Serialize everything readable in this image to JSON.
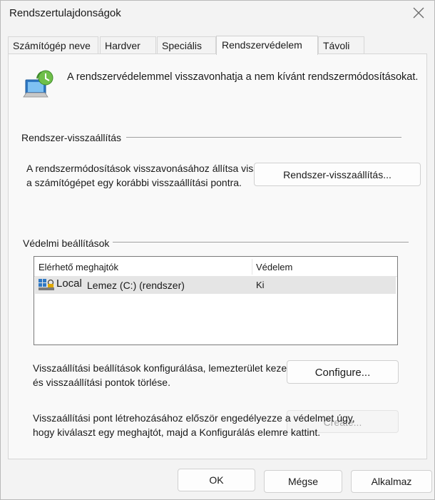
{
  "window": {
    "title": "Rendszertulajdonságok",
    "close_icon": "close-icon"
  },
  "tabs": [
    {
      "label": "Számítógép neve"
    },
    {
      "label": "Hardver"
    },
    {
      "label": "Speciális"
    },
    {
      "label": "Rendszervédelem"
    },
    {
      "label": "Távoli"
    }
  ],
  "header": {
    "icon": "system-protection-icon",
    "description": "A rendszervédelemmel visszavonhatja a nem kívánt rendszermódosításokat."
  },
  "restore": {
    "group_label": "Rendszer-visszaállítás",
    "text_line1": "A rendszermódosítások visszavonásához állítsa vissza",
    "text_line2": "a számítógépet egy korábbi visszaállítási pontra.",
    "button_label": "Rendszer-visszaállítás..."
  },
  "protection": {
    "group_label": "Védelmi beállítások",
    "columns": {
      "drives": "Elérhető meghajtók",
      "protection": "Védelem"
    },
    "drives": [
      {
        "name_part1": "Local",
        "name_part2": "Lemez (C:) (rendszer)",
        "protection": "Ki",
        "icon": "drive-icon"
      }
    ],
    "configure_text_line1": "Visszaállítási beállítások konfigurálása, lemezterület kezelése",
    "configure_text_line2": "és visszaállítási pontok törlése.",
    "configure_button": "Configure...",
    "create_text_line1": "Visszaállítási pont létrehozásához először engedélyezze a védelmet úgy,",
    "create_text_line2": "hogy kiválaszt egy meghajtót, majd a Konfigurálás elemre kattint.",
    "create_button": "Create..."
  },
  "footer": {
    "ok": "OK",
    "cancel": "Mégse",
    "apply": "Alkalmaz"
  },
  "colors": {
    "window_bg": "#f3f3f3",
    "panel_bg": "#f9f9f9",
    "selection": "#e5e5e5",
    "accent": "#0067c0"
  }
}
